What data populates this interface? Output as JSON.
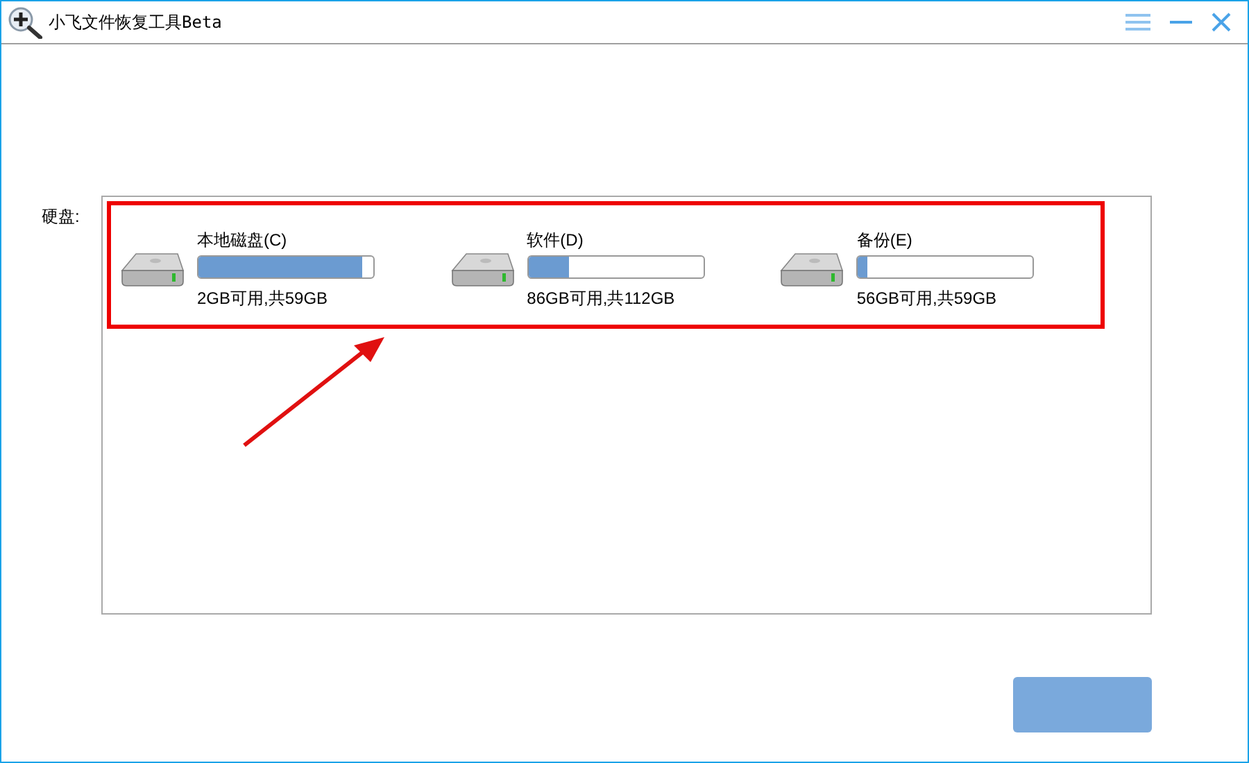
{
  "window": {
    "title": "小飞文件恢复工具Beta"
  },
  "disks_label": "硬盘:",
  "disks": [
    {
      "name": "本地磁盘(C)",
      "level": 0.94,
      "info": "2GB可用,共59GB"
    },
    {
      "name": "软件(D)",
      "level": 0.23,
      "info": "86GB可用,共112GB"
    },
    {
      "name": "备份(E)",
      "level": 0.05,
      "info": "56GB可用,共59GB"
    }
  ]
}
